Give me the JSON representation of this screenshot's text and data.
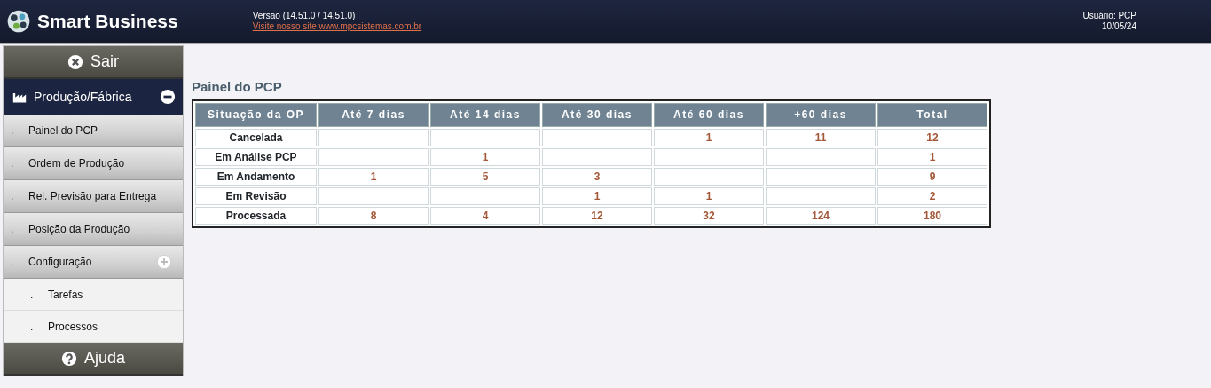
{
  "header": {
    "app_name": "Smart Business",
    "version": "Versão (14.51.0 / 14.51.0)",
    "site_link": "Visite nosso site www.mpcsistemas.com.br",
    "user": "Usuário: PCP",
    "date": "10/05/24"
  },
  "sidebar": {
    "exit_button": "Sair",
    "group": {
      "label": "Produção/Fábrica",
      "expanded": true,
      "items": [
        {
          "marker": ".",
          "label": "Painel do PCP"
        },
        {
          "marker": ".",
          "label": "Ordem de Produção"
        },
        {
          "marker": ".",
          "label": "Rel. Previsão para Entrega"
        },
        {
          "marker": ".",
          "label": "Posição da Produção"
        },
        {
          "marker": ".",
          "label": "Configuração",
          "children": [
            {
              "marker": ".",
              "label": "Tarefas"
            },
            {
              "marker": ".",
              "label": "Processos"
            }
          ]
        }
      ]
    },
    "help_button": "Ajuda"
  },
  "panel": {
    "title": "Painel do PCP",
    "table": {
      "columns": [
        "Situação da OP",
        "Até 7 dias",
        "Até 14 dias",
        "Até 30 dias",
        "Até 60 dias",
        "+60 dias",
        "Total"
      ],
      "rows": [
        {
          "cells": [
            "Cancelada",
            "",
            "",
            "",
            "1",
            "11",
            "12"
          ]
        },
        {
          "cells": [
            "Em Análise PCP",
            "",
            "1",
            "",
            "",
            "",
            "1"
          ]
        },
        {
          "cells": [
            "Em Andamento",
            "1",
            "5",
            "3",
            "",
            "",
            "9"
          ]
        },
        {
          "cells": [
            "Em Revisão",
            "",
            "",
            "1",
            "1",
            "",
            "2"
          ]
        },
        {
          "cells": [
            "Processada",
            "8",
            "4",
            "12",
            "32",
            "124",
            "180"
          ]
        }
      ]
    }
  }
}
